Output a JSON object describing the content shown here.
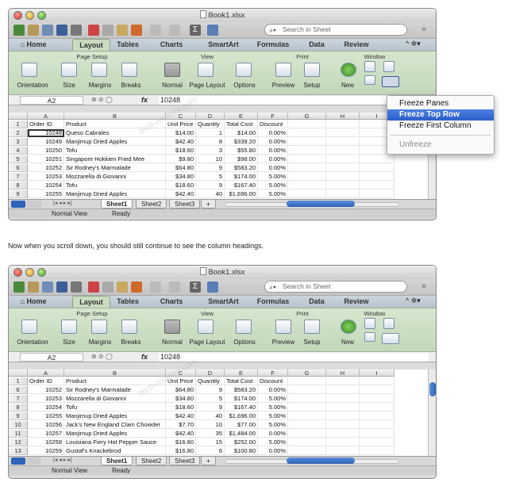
{
  "window": {
    "title": "Book1.xlsx"
  },
  "search": {
    "placeholder": "Search in Sheet"
  },
  "tabs": [
    "Home",
    "Layout",
    "Tables",
    "Charts",
    "SmartArt",
    "Formulas",
    "Data",
    "Review"
  ],
  "ribbon": {
    "groups": {
      "page_setup": "Page Setup",
      "view": "View",
      "print": "Print",
      "window": "Window"
    },
    "buttons": {
      "orientation": "Orientation",
      "size": "Size",
      "margins": "Margins",
      "breaks": "Breaks",
      "normal": "Normal",
      "page_layout": "Page Layout",
      "options": "Options",
      "preview": "Preview",
      "setup": "Setup",
      "new": "New"
    }
  },
  "formula_bar": {
    "cell_ref": "A2",
    "fx": "fx",
    "value": "10248"
  },
  "columns": [
    "A",
    "B",
    "C",
    "D",
    "E",
    "F",
    "G",
    "H",
    "I"
  ],
  "header_row": [
    "Order ID",
    "Product",
    "Unit Price",
    "Quantity",
    "Total Cost",
    "Discount"
  ],
  "sheet1_rows": [
    [
      "10248",
      "Queso Cabrales",
      "$14.00",
      "1",
      "$14.00",
      "0.00%"
    ],
    [
      "10249",
      "Manjimup Dried Apples",
      "$42.40",
      "8",
      "$339.20",
      "0.00%"
    ],
    [
      "10250",
      "Tofu",
      "$18.60",
      "3",
      "$55.80",
      "0.00%"
    ],
    [
      "10251",
      "Singapore Hokkien Fried Mee",
      "$9.80",
      "10",
      "$98.00",
      "0.00%"
    ],
    [
      "10252",
      "Sir Rodney's Marmalade",
      "$64.80",
      "9",
      "$583.20",
      "0.00%"
    ],
    [
      "10253",
      "Mozzarella di Giovanni",
      "$34.80",
      "5",
      "$174.00",
      "5.00%"
    ],
    [
      "10254",
      "Tofu",
      "$18.60",
      "9",
      "$167.40",
      "5.00%"
    ],
    [
      "10255",
      "Manjimup Dried Apples",
      "$42.40",
      "40",
      "$1,696.00",
      "5.00%"
    ]
  ],
  "scrolled_rows": [
    [
      "10252",
      "Sir Rodney's Marmalade",
      "$64.80",
      "9",
      "$583.20",
      "0.00%"
    ],
    [
      "10253",
      "Mozzarella di Giovanni",
      "$34.80",
      "5",
      "$174.00",
      "5.00%"
    ],
    [
      "10254",
      "Tofu",
      "$18.60",
      "9",
      "$167.40",
      "5.00%"
    ],
    [
      "10255",
      "Manjimup Dried Apples",
      "$42.40",
      "40",
      "$1,696.00",
      "5.00%"
    ],
    [
      "10256",
      "Jack's New England Clam Chowder",
      "$7.70",
      "10",
      "$77.00",
      "5.00%"
    ],
    [
      "10257",
      "Manjimup Dried Apples",
      "$42.40",
      "35",
      "$1,484.00",
      "0.00%"
    ],
    [
      "10258",
      "Louisiana Fiery Hot Pepper Sauce",
      "$16.80",
      "15",
      "$252.00",
      "5.00%"
    ],
    [
      "10259",
      "Gustaf's Knackebrod",
      "$16.80",
      "6",
      "$100.80",
      "0.00%"
    ]
  ],
  "row_numbers_1": [
    "1",
    "2",
    "3",
    "4",
    "5",
    "6",
    "7",
    "8",
    "9"
  ],
  "row_numbers_2": [
    "1",
    "6",
    "7",
    "8",
    "9",
    "10",
    "11",
    "12",
    "13"
  ],
  "sheets": [
    "Sheet1",
    "Sheet2",
    "Sheet3",
    "+"
  ],
  "status": {
    "view": "Normal View",
    "state": "Ready"
  },
  "freeze_menu": [
    "Freeze Panes",
    "Freeze Top Row",
    "Freeze First Column",
    "Unfreeze"
  ],
  "caption": "Now when you scroll down, you should still continue to see the column headings.",
  "watermark": "tech-recipes.com",
  "colors": {
    "ribbon": "#c9dcc1",
    "menu_highlight": "#2d5fc9",
    "scroll_thumb": "#2e63b8"
  }
}
